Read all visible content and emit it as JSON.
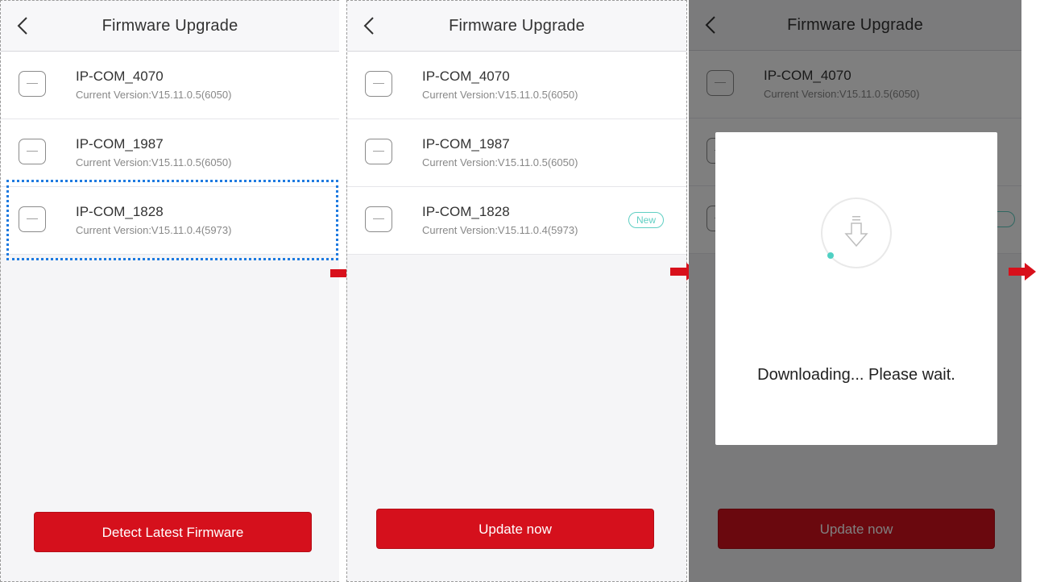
{
  "screens": [
    {
      "title": "Firmware Upgrade",
      "devices": [
        {
          "name": "IP-COM_4070",
          "version": "Current Version:V15.11.0.5(6050)"
        },
        {
          "name": "IP-COM_1987",
          "version": "Current Version:V15.11.0.5(6050)"
        },
        {
          "name": "IP-COM_1828",
          "version": "Current Version:V15.11.0.4(5973)"
        }
      ],
      "button": "Detect Latest Firmware"
    },
    {
      "title": "Firmware Upgrade",
      "devices": [
        {
          "name": "IP-COM_4070",
          "version": "Current Version:V15.11.0.5(6050)"
        },
        {
          "name": "IP-COM_1987",
          "version": "Current Version:V15.11.0.5(6050)"
        },
        {
          "name": "IP-COM_1828",
          "version": "Current Version:V15.11.0.4(5973)",
          "badge": "New"
        }
      ],
      "button": "Update now"
    },
    {
      "title": "Firmware Upgrade",
      "devices": [
        {
          "name": "IP-COM_4070",
          "version": "Current Version:V15.11.0.5(6050)"
        }
      ],
      "dialog_text": "Downloading... Please wait.",
      "button": "Update now"
    }
  ],
  "colors": {
    "primary_red": "#d5101c",
    "accent_teal": "#5fcfc3",
    "selection_blue": "#1e7ae0",
    "arrow_red": "#d8101b"
  },
  "icons": {
    "back": "chevron-left-icon",
    "device": "access-point-icon",
    "download": "download-arrow-icon",
    "step_arrow": "right-arrow-icon"
  }
}
